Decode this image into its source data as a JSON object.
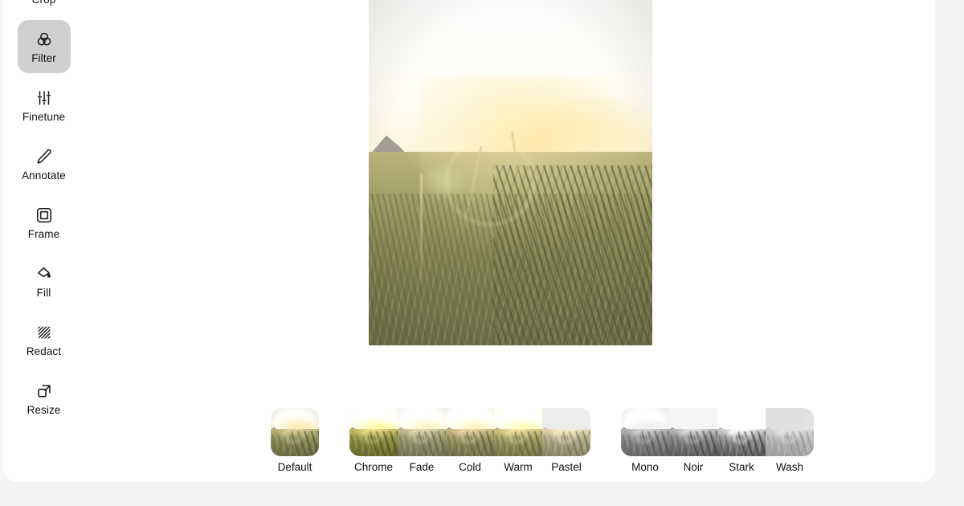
{
  "app": {
    "background_color": "#f4f4f7",
    "card_color": "#ffffff"
  },
  "sidebar": {
    "name": "tool-rail",
    "active_tool": "Filter",
    "active_background": "#d0d0d0",
    "items": [
      {
        "label": "Crop",
        "icon": "crop-icon",
        "active": false
      },
      {
        "label": "Filter",
        "icon": "filter-icon",
        "active": true
      },
      {
        "label": "Finetune",
        "icon": "finetune-icon",
        "active": false
      },
      {
        "label": "Annotate",
        "icon": "annotate-icon",
        "active": false
      },
      {
        "label": "Frame",
        "icon": "frame-icon",
        "active": false
      },
      {
        "label": "Fill",
        "icon": "fill-icon",
        "active": false
      },
      {
        "label": "Redact",
        "icon": "redact-icon",
        "active": false
      },
      {
        "label": "Resize",
        "icon": "resize-icon",
        "active": false
      }
    ]
  },
  "canvas": {
    "name": "image-preview",
    "image_description": "Sunrise over a grassy meadow with hills and lens flare"
  },
  "filter_strip": {
    "name": "filter-strip",
    "groups": [
      {
        "name": "basic-filters",
        "items": [
          {
            "label": "Default",
            "look": "look-default"
          }
        ]
      },
      {
        "name": "color-filters",
        "items": [
          {
            "label": "Chrome",
            "look": "look-chrome"
          },
          {
            "label": "Fade",
            "look": "look-fade"
          },
          {
            "label": "Cold",
            "look": "look-cold"
          },
          {
            "label": "Warm",
            "look": "look-warm"
          },
          {
            "label": "Pastel",
            "look": "look-pastel"
          }
        ]
      },
      {
        "name": "monochrome-filters",
        "items": [
          {
            "label": "Mono",
            "look": "look-mono"
          },
          {
            "label": "Noir",
            "look": "look-noir"
          },
          {
            "label": "Stark",
            "look": "look-stark"
          },
          {
            "label": "Wash",
            "look": "look-wash"
          }
        ]
      }
    ]
  }
}
